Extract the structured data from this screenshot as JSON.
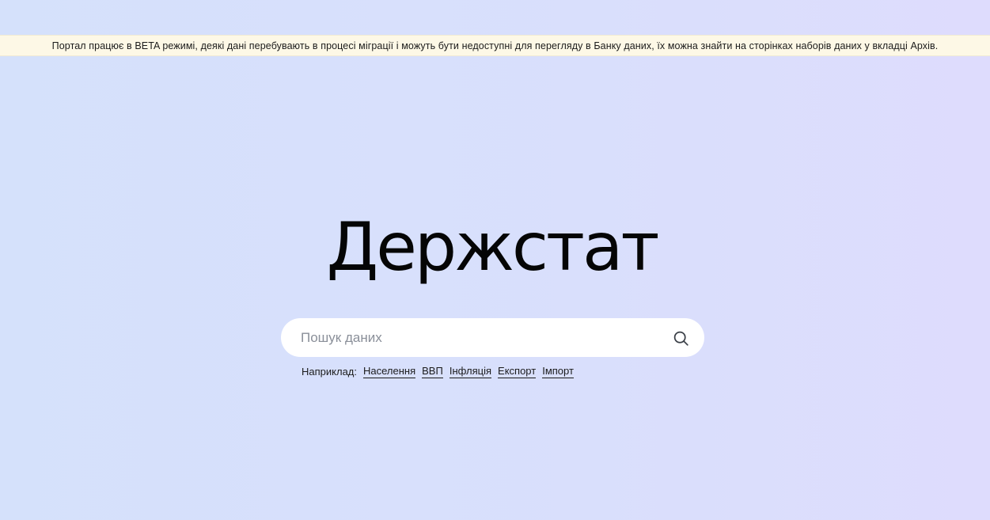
{
  "banner": {
    "text": "Портал працює в BETA режимі, деякі дані перебувають в процесі міграції і можуть бути недоступні для перегляду в Банку даних, їх можна знайти на сторінках наборів даних у вкладці Архів."
  },
  "logo": {
    "text": "Держстат"
  },
  "search": {
    "placeholder": "Пошук даних",
    "value": "",
    "icon": "search-icon"
  },
  "examples": {
    "label": "Наприклад:",
    "links": [
      "Населення",
      "ВВП",
      "Інфляція",
      "Експорт",
      "Імпорт"
    ]
  },
  "colors": {
    "background": "#d8e0fb",
    "banner_background": "#fdf8e6",
    "search_background": "#ffffff"
  }
}
